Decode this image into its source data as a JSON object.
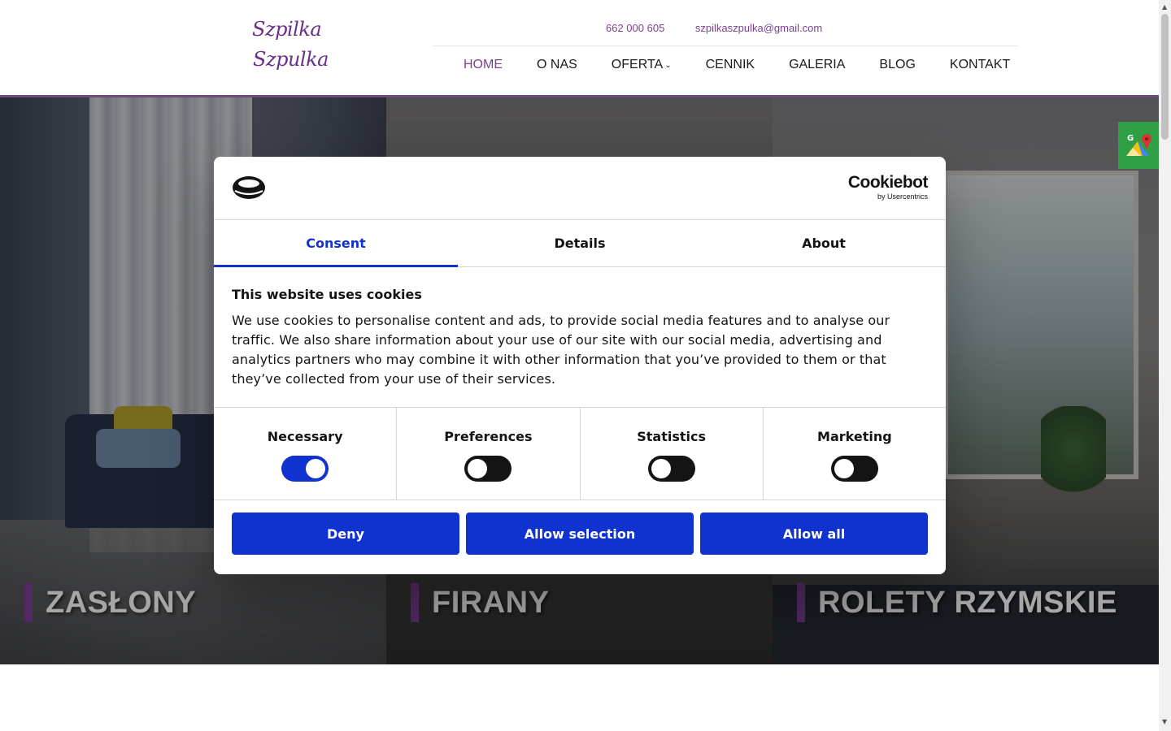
{
  "header": {
    "logo": {
      "line1": "Szpilka",
      "line2": "Szpulka"
    },
    "phone": "662 000 605",
    "email": "szpilkaszpulka@gmail.com",
    "nav": [
      {
        "label": "HOME",
        "active": true
      },
      {
        "label": "O NAS"
      },
      {
        "label": "OFERTA",
        "has_dropdown": true
      },
      {
        "label": "CENNIK"
      },
      {
        "label": "GALERIA"
      },
      {
        "label": "BLOG"
      },
      {
        "label": "KONTAKT"
      }
    ]
  },
  "hero": {
    "panels": [
      {
        "label": "ZASŁONY"
      },
      {
        "label": "FIRANY"
      },
      {
        "label": "ROLETY RZYMSKIE"
      }
    ]
  },
  "cookie_dialog": {
    "brand": "Cookiebot",
    "brand_sub": "by Usercentrics",
    "tabs": [
      {
        "label": "Consent",
        "active": true
      },
      {
        "label": "Details"
      },
      {
        "label": "About"
      }
    ],
    "title": "This website uses cookies",
    "text": "We use cookies to personalise content and ads, to provide social media features and to analyse our traffic. We also share information about your use of our site with our social media, advertising and analytics partners who may combine it with other information that you’ve provided to them or that they’ve collected from your use of their services.",
    "categories": [
      {
        "label": "Necessary",
        "enabled": true
      },
      {
        "label": "Preferences",
        "enabled": false
      },
      {
        "label": "Statistics",
        "enabled": false
      },
      {
        "label": "Marketing",
        "enabled": false
      }
    ],
    "buttons": {
      "deny": "Deny",
      "allow_selection": "Allow selection",
      "allow_all": "Allow all"
    }
  },
  "colors": {
    "brand_purple": "#7a3f93",
    "cookie_blue": "#1032cf",
    "maps_green": "#2fa046"
  },
  "icons": {
    "maps_badge": "google-maps-icon",
    "cookie_logo": "cookiebot-logo-icon"
  }
}
